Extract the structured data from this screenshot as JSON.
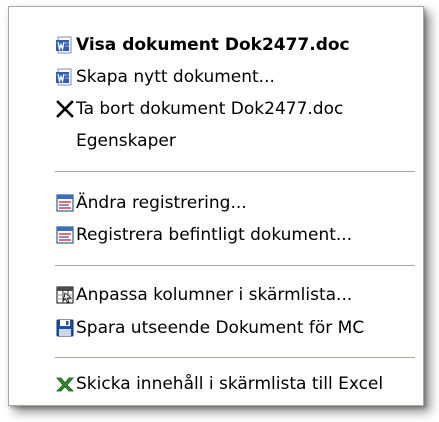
{
  "menu": {
    "items": [
      {
        "label": "Visa dokument Dok2477.doc",
        "icon": "word-doc-icon",
        "bold": true
      },
      {
        "label": "Skapa nytt dokument...",
        "icon": "word-doc-icon"
      },
      {
        "label": "Ta bort dokument Dok2477.doc",
        "icon": "delete-x-icon"
      },
      {
        "label": "Egenskaper",
        "icon": ""
      },
      {
        "label": "Ändra registrering...",
        "icon": "registration-form-icon"
      },
      {
        "label": "Registrera befintligt dokument...",
        "icon": "registration-form-icon"
      },
      {
        "label": "Anpassa kolumner i skärmlista...",
        "icon": "columns-icon"
      },
      {
        "label": "Spara utseende Dokument för MC",
        "icon": "floppy-disk-icon"
      },
      {
        "label": "Skicka innehåll i skärmlista till Excel",
        "icon": "excel-icon"
      }
    ]
  },
  "colors": {
    "border": "#aca899",
    "separator": "#aca899",
    "word_blue": "#2f5fb3",
    "excel_green": "#2f8f2f",
    "floppy_blue": "#1f4fa3"
  }
}
